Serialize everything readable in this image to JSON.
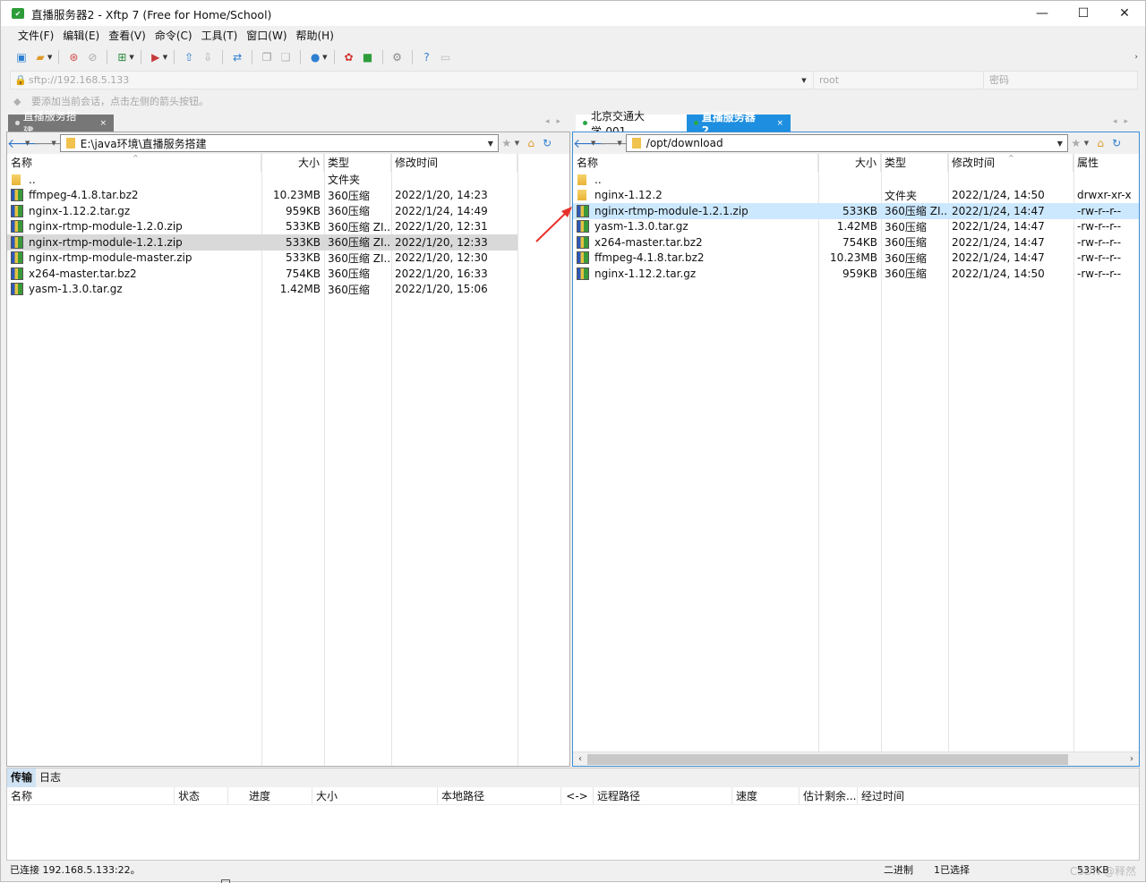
{
  "window": {
    "title": "直播服务器2 - Xftp 7 (Free for Home/School)",
    "controls": {
      "minimize": "—",
      "maximize": "☐",
      "close": "✕"
    }
  },
  "menu": [
    "文件(F)",
    "编辑(E)",
    "查看(V)",
    "命令(C)",
    "工具(T)",
    "窗口(W)",
    "帮助(H)"
  ],
  "toolbar_icons": [
    "new-session-icon",
    "open-folder-icon",
    "connect-icon",
    "disconnect-icon",
    "new-window-icon",
    "transfer-icon",
    "upload-icon",
    "download-icon",
    "sync-icon",
    "copy-icon",
    "paste-icon",
    "globe-icon",
    "xshell-icon",
    "xftp-icon",
    "settings-icon",
    "help-icon",
    "chat-icon"
  ],
  "address": {
    "url_placeholder": "sftp://192.168.5.133",
    "user_placeholder": "root",
    "password_placeholder": "密码"
  },
  "hint": "要添加当前会话，点击左侧的箭头按钮。",
  "left_tabs": [
    {
      "label": "直播服务搭建",
      "close": "×",
      "active": true
    }
  ],
  "right_tabs": [
    {
      "label": "北京交通大学-001",
      "active": false
    },
    {
      "label": "直播服务器2",
      "close": "×",
      "active": true
    }
  ],
  "left_pane": {
    "path": "E:\\java环境\\直播服务搭建",
    "columns": [
      "名称",
      "大小",
      "类型",
      "修改时间"
    ],
    "rows": [
      {
        "name": "..",
        "size": "",
        "type": "文件夹",
        "modified": "",
        "icon": "folder"
      },
      {
        "name": "ffmpeg-4.1.8.tar.bz2",
        "size": "10.23MB",
        "type": "360压缩",
        "modified": "2022/1/20, 14:23",
        "icon": "archive"
      },
      {
        "name": "nginx-1.12.2.tar.gz",
        "size": "959KB",
        "type": "360压缩",
        "modified": "2022/1/24, 14:49",
        "icon": "archive"
      },
      {
        "name": "nginx-rtmp-module-1.2.0.zip",
        "size": "533KB",
        "type": "360压缩 ZI...",
        "modified": "2022/1/20, 12:31",
        "icon": "archive"
      },
      {
        "name": "nginx-rtmp-module-1.2.1.zip",
        "size": "533KB",
        "type": "360压缩 ZI...",
        "modified": "2022/1/20, 12:33",
        "icon": "archive",
        "highlight": true
      },
      {
        "name": "nginx-rtmp-module-master.zip",
        "size": "533KB",
        "type": "360压缩 ZI...",
        "modified": "2022/1/20, 12:30",
        "icon": "archive"
      },
      {
        "name": "x264-master.tar.bz2",
        "size": "754KB",
        "type": "360压缩",
        "modified": "2022/1/20, 16:33",
        "icon": "archive"
      },
      {
        "name": "yasm-1.3.0.tar.gz",
        "size": "1.42MB",
        "type": "360压缩",
        "modified": "2022/1/20, 15:06",
        "icon": "archive"
      }
    ]
  },
  "right_pane": {
    "path": "/opt/download",
    "columns": [
      "名称",
      "大小",
      "类型",
      "修改时间",
      "属性"
    ],
    "rows": [
      {
        "name": "..",
        "size": "",
        "type": "",
        "modified": "",
        "attrs": "",
        "icon": "folder"
      },
      {
        "name": "nginx-1.12.2",
        "size": "",
        "type": "文件夹",
        "modified": "2022/1/24, 14:50",
        "attrs": "drwxr-xr-x",
        "icon": "folder"
      },
      {
        "name": "nginx-rtmp-module-1.2.1.zip",
        "size": "533KB",
        "type": "360压缩 ZI...",
        "modified": "2022/1/24, 14:47",
        "attrs": "-rw-r--r--",
        "icon": "archive",
        "selected": true
      },
      {
        "name": "yasm-1.3.0.tar.gz",
        "size": "1.42MB",
        "type": "360压缩",
        "modified": "2022/1/24, 14:47",
        "attrs": "-rw-r--r--",
        "icon": "archive"
      },
      {
        "name": "x264-master.tar.bz2",
        "size": "754KB",
        "type": "360压缩",
        "modified": "2022/1/24, 14:47",
        "attrs": "-rw-r--r--",
        "icon": "archive"
      },
      {
        "name": "ffmpeg-4.1.8.tar.bz2",
        "size": "10.23MB",
        "type": "360压缩",
        "modified": "2022/1/24, 14:47",
        "attrs": "-rw-r--r--",
        "icon": "archive"
      },
      {
        "name": "nginx-1.12.2.tar.gz",
        "size": "959KB",
        "type": "360压缩",
        "modified": "2022/1/24, 14:50",
        "attrs": "-rw-r--r--",
        "icon": "archive"
      }
    ]
  },
  "transfer": {
    "tabs": [
      "传输",
      "日志"
    ],
    "columns": [
      "名称",
      "状态",
      "进度",
      "大小",
      "本地路径",
      "<->",
      "远程路径",
      "速度",
      "估计剩余...",
      "经过时间"
    ]
  },
  "status": {
    "connection": "已连接 192.168.5.133:22。",
    "mode": "二进制",
    "selection": "1已选择",
    "size": "533KB"
  },
  "watermark": "CSDN @释然",
  "colors": {
    "accent": "#0a84d9",
    "selected_row": "#cce8ff",
    "active_tab": "#1e8fe0",
    "arrow": "#e8302a"
  }
}
